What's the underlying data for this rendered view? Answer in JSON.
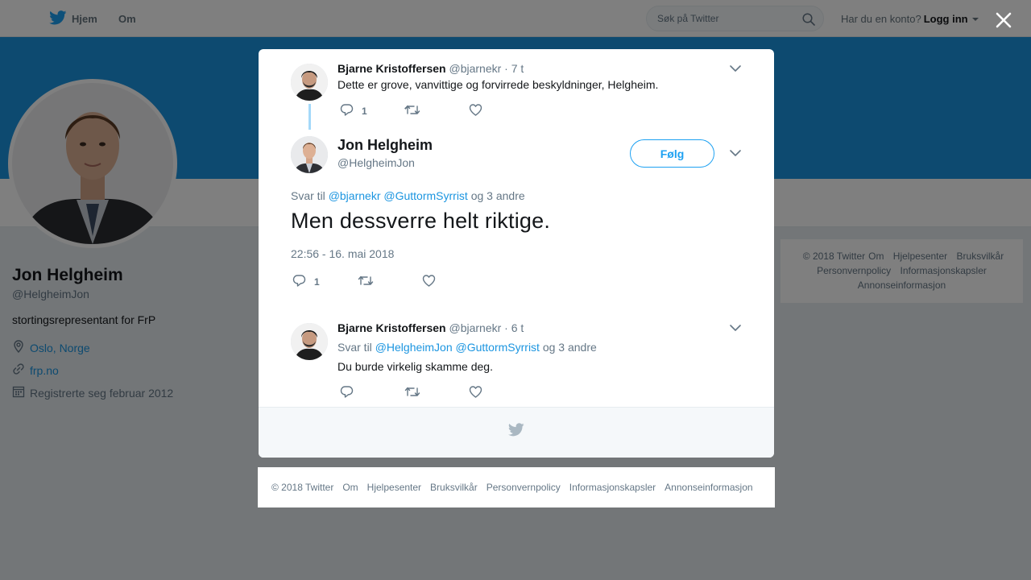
{
  "nav": {
    "home_label": "Hjem",
    "about_label": "Om",
    "search_placeholder": "Søk på Twitter",
    "login_prompt": "Har du en konto?",
    "login_label": "Logg inn"
  },
  "profile": {
    "name": "Jon Helgheim",
    "handle": "@HelgheimJon",
    "bio": "stortingsrepresentant for FrP",
    "location": "Oslo, Norge",
    "website": "frp.no",
    "joined": "Registrerte seg februar 2012"
  },
  "side_footer": {
    "items": [
      "© 2018 Twitter",
      "Om",
      "Hjelpesenter",
      "Bruksvilkår",
      "Personvernpolicy",
      "Informasjonskapsler",
      "Annonseinformasjon"
    ]
  },
  "modal": {
    "parent_tweet": {
      "name": "Bjarne Kristoffersen",
      "handle": "@bjarnekr",
      "time": "· 7 t",
      "text": "Dette er grove, vanvittige og forvirrede beskyldninger, Helgheim.",
      "reply_count": "1"
    },
    "main_tweet": {
      "name": "Jon Helgheim",
      "handle": "@HelgheimJon",
      "follow_label": "Følg",
      "replying_prefix": "Svar til",
      "reply_to_1": "@bjarnekr",
      "reply_to_2": "@GuttormSyrrist",
      "replying_suffix": "og 3 andre",
      "text": "Men dessverre helt riktige.",
      "timestamp": "22:56 - 16. mai 2018",
      "reply_count": "1"
    },
    "reply_tweet": {
      "name": "Bjarne Kristoffersen",
      "handle": "@bjarnekr",
      "time": "· 6 t",
      "replying_prefix": "Svar til",
      "reply_to_1": "@HelgheimJon",
      "reply_to_2": "@GuttormSyrrist",
      "replying_suffix": "og 3 andre",
      "text": "Du burde virkelig skamme deg."
    }
  },
  "bottom_footer": {
    "items": [
      "© 2018 Twitter",
      "Om",
      "Hjelpesenter",
      "Bruksvilkår",
      "Personvernpolicy",
      "Informasjonskapsler",
      "Annonseinformasjon"
    ]
  },
  "colors": {
    "brand_blue": "#1da1f2",
    "link_blue": "#1b95e0",
    "banner_blue": "#1b95e0",
    "thread_line": "#a4d9f9"
  },
  "icons": {
    "logo": "twitter-bird-icon",
    "search": "search-icon",
    "close": "close-icon",
    "location": "location-pin-icon",
    "link": "link-icon",
    "calendar": "calendar-icon",
    "reply": "reply-icon",
    "retweet": "retweet-icon",
    "like": "heart-icon",
    "more": "chevron-down-icon"
  }
}
